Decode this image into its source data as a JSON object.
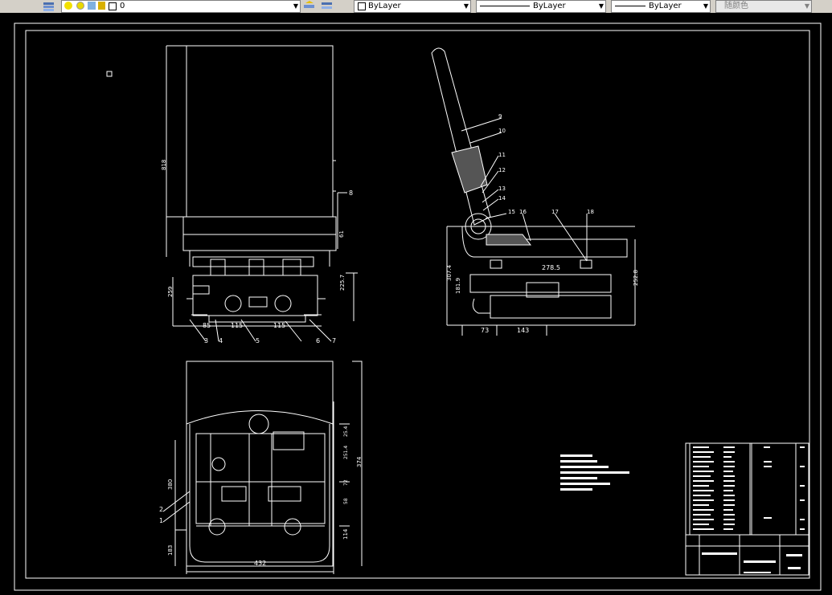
{
  "toolbar": {
    "layer_value": "0",
    "color_value": "ByLayer",
    "linetype_value": "ByLayer",
    "lineweight_value": "ByLayer",
    "plotstyle_value": "随颜色"
  },
  "drawing": {
    "front_view": {
      "dim_height": "818",
      "dim_base": "259",
      "dim_seat": "225.7",
      "dim_small": "61",
      "dim_a": "85",
      "dim_b": "115",
      "dim_c": "115",
      "parts": [
        "3",
        "4",
        "5",
        "6",
        "7",
        "8"
      ]
    },
    "side_view": {
      "dim_seat_len": "278.5",
      "dim_total_h": "307.4",
      "dim_inner_h": "181.9",
      "dim_right_h": "252.8",
      "dim_x1": "73",
      "dim_x2": "143",
      "parts": [
        "9",
        "10",
        "11",
        "12",
        "13",
        "14",
        "15",
        "16",
        "17",
        "18"
      ]
    },
    "top_view": {
      "dim_width": "432",
      "dim_depth": "374",
      "dim_left": "380",
      "dim_bottom": "183",
      "dim_rb": "114",
      "dim_r1": "25.4",
      "dim_r2": "251.4",
      "dim_r3": "72",
      "dim_r4": "58",
      "parts": [
        "1",
        "2"
      ]
    }
  }
}
